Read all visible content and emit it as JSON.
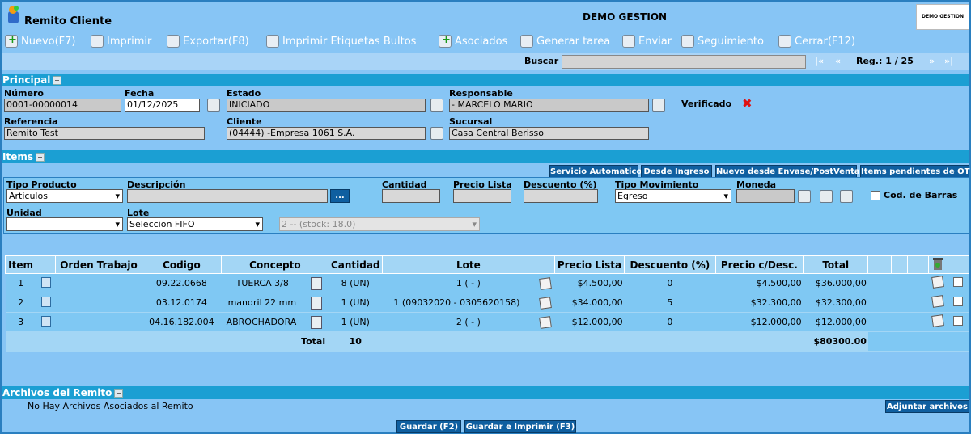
{
  "app": {
    "title": "Remito Cliente",
    "company": "DEMO GESTION",
    "brand": "DEMO GESTION"
  },
  "toolbar": {
    "new": "Nuevo(F7)",
    "print": "Imprimir",
    "export": "Exportar(F8)",
    "print_labels": "Imprimir Etiquetas Bultos",
    "associated": "Asociados",
    "generate_task": "Generar tarea",
    "send": "Enviar",
    "tracking": "Seguimiento",
    "close": "Cerrar(F12)"
  },
  "search": {
    "label": "Buscar",
    "value": "",
    "first": "|«",
    "prev": "«",
    "next": "»",
    "last": "»|",
    "reg_label": "Reg.: 1 / 25"
  },
  "principal": {
    "title": "Principal",
    "numero_label": "Número",
    "numero": "0001-00000014",
    "fecha_label": "Fecha",
    "fecha": "01/12/2025",
    "estado_label": "Estado",
    "estado": "INICIADO",
    "responsable_label": "Responsable",
    "responsable": "- MARCELO MARIO",
    "verificado_label": "Verificado",
    "referencia_label": "Referencia",
    "referencia": "Remito Test",
    "cliente_label": "Cliente",
    "cliente": "(04444) -Empresa 1061 S.A.",
    "sucursal_label": "Sucursal",
    "sucursal": "Casa Central Berisso"
  },
  "items": {
    "title": "Items",
    "buttons": {
      "auto_service": "Servicio Automatico",
      "from_income": "Desde Ingreso",
      "new_from_package": "Nuevo desde Envase/PostVenta",
      "pending_ot": "Items pendientes de OT"
    },
    "form": {
      "tipo_producto_label": "Tipo Producto",
      "tipo_producto": "Articulos",
      "descripcion_label": "Descripción",
      "descripcion": "",
      "dots": "...",
      "cantidad_label": "Cantidad",
      "precio_lista_label": "Precio Lista",
      "descuento_label": "Descuento (%)",
      "tipo_movimiento_label": "Tipo Movimiento",
      "tipo_movimiento": "Egreso",
      "moneda_label": "Moneda",
      "cod_barras_label": "Cod. de Barras",
      "unidad_label": "Unidad",
      "unidad": "",
      "lote_label": "Lote",
      "lote": "Seleccion FIFO",
      "stock": "2 -- (stock: 18.0)"
    },
    "columns": [
      "Item",
      "",
      "Orden Trabajo",
      "Codigo",
      "Concepto",
      "Cantidad",
      "Lote",
      "Precio Lista",
      "Descuento (%)",
      "Precio c/Desc.",
      "Total"
    ],
    "rows": [
      {
        "item": "1",
        "orden": "",
        "codigo": "09.22.0668",
        "concepto": "TUERCA 3/8",
        "cantidad": "8 (UN)",
        "lote": "1 ( - )",
        "precio_lista": "$4.500,00",
        "descuento": "0",
        "precio_desc": "$4.500,00",
        "total": "$36.000,00"
      },
      {
        "item": "2",
        "orden": "",
        "codigo": "03.12.0174",
        "concepto": "mandril 22 mm",
        "cantidad": "1 (UN)",
        "lote": "1 (09032020 - 0305620158)",
        "precio_lista": "$34.000,00",
        "descuento": "5",
        "precio_desc": "$32.300,00",
        "total": "$32.300,00"
      },
      {
        "item": "3",
        "orden": "",
        "codigo": "04.16.182.004",
        "concepto": "ABROCHADORA",
        "cantidad": "1 (UN)",
        "lote": "2 ( - )",
        "precio_lista": "$12.000,00",
        "descuento": "0",
        "precio_desc": "$12.000,00",
        "total": "$12.000,00"
      }
    ],
    "total_label": "Total",
    "total_qty": "10",
    "total_amount": "$80300.00"
  },
  "archivos": {
    "title": "Archivos del Remito",
    "empty": "No Hay Archivos Asociados al Remito",
    "attach": "Adjuntar archivos"
  },
  "footer": {
    "save": "Guardar (F2)",
    "save_print": "Guardar e Imprimir (F3)"
  }
}
